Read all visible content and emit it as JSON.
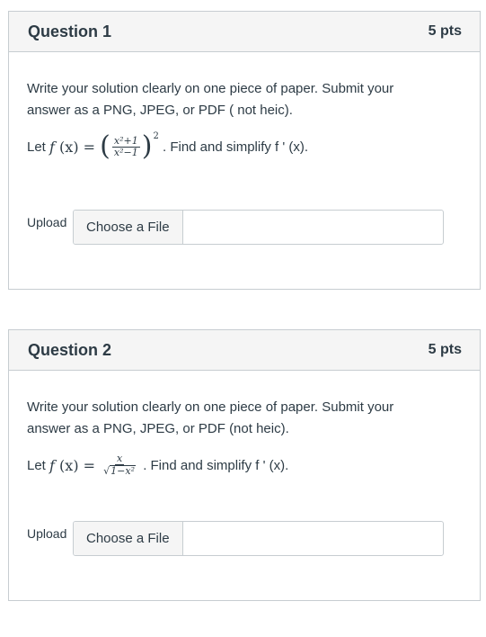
{
  "questions": [
    {
      "title": "Question 1",
      "points": "5 pts",
      "instruction": "Write your solution clearly on one piece of paper.  Submit your answer as a PNG, JPEG, or PDF  ( not heic).",
      "let": "Let",
      "formula": {
        "f": "f",
        "x": "(x)",
        "eq": "=",
        "num": "x²+1",
        "den": "x²−1",
        "exp": "2"
      },
      "task": ". Find and simplify  f ' (x).",
      "upload_label": "Upload",
      "choose_file": "Choose a File"
    },
    {
      "title": "Question 2",
      "points": "5 pts",
      "instruction": "Write your solution clearly on one piece of paper.  Submit your answer as a PNG, JPEG, or PDF  (not heic).",
      "let": "Let",
      "formula": {
        "f": "f",
        "x": "(x)",
        "eq": "=",
        "num": "x",
        "den": "1−x²"
      },
      "task": ". Find and simplify  f ' (x).",
      "upload_label": "Upload",
      "choose_file": "Choose a File"
    }
  ]
}
